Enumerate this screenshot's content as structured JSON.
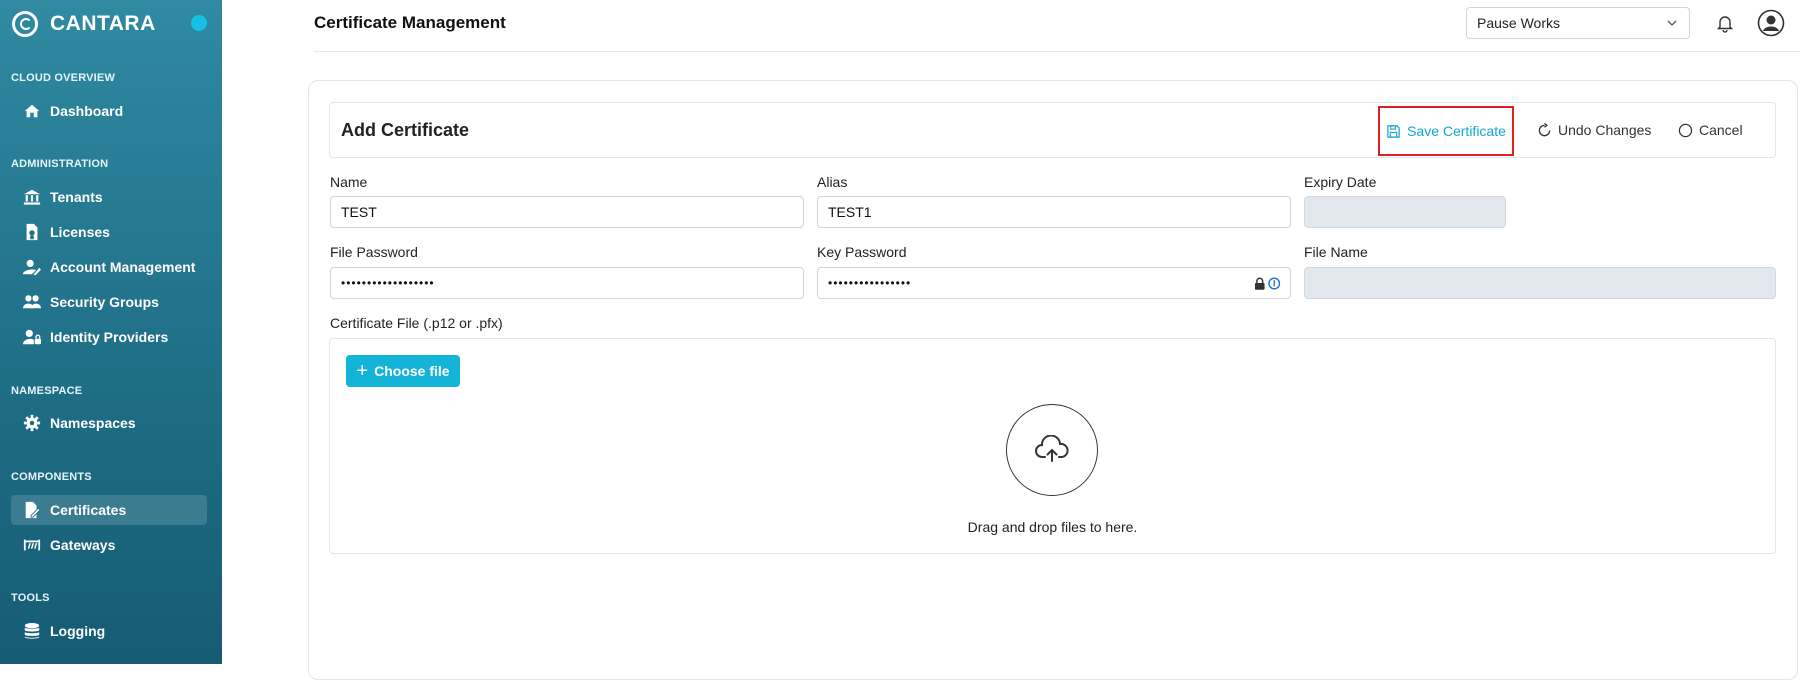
{
  "brand": {
    "name": "CANTARA",
    "status_color": "#16c0e4"
  },
  "sidebar": {
    "sections": [
      {
        "title": "CLOUD OVERVIEW",
        "items": [
          {
            "label": "Dashboard",
            "icon": "home-icon"
          }
        ]
      },
      {
        "title": "ADMINISTRATION",
        "items": [
          {
            "label": "Tenants",
            "icon": "bank-icon"
          },
          {
            "label": "Licenses",
            "icon": "license-icon"
          },
          {
            "label": "Account Management",
            "icon": "user-edit-icon"
          },
          {
            "label": "Security Groups",
            "icon": "users-icon"
          },
          {
            "label": "Identity Providers",
            "icon": "user-lock-icon"
          }
        ]
      },
      {
        "title": "NAMESPACE",
        "items": [
          {
            "label": "Namespaces",
            "icon": "gear-icon"
          }
        ]
      },
      {
        "title": "COMPONENTS",
        "items": [
          {
            "label": "Certificates",
            "icon": "certificate-icon",
            "active": true
          },
          {
            "label": "Gateways",
            "icon": "gateway-icon"
          }
        ]
      },
      {
        "title": "TOOLS",
        "items": [
          {
            "label": "Logging",
            "icon": "database-icon"
          }
        ]
      }
    ]
  },
  "header": {
    "title": "Certificate Management",
    "tenant_selected": "Pause Works"
  },
  "form": {
    "title": "Add Certificate",
    "actions": {
      "save": "Save Certificate",
      "undo": "Undo Changes",
      "cancel": "Cancel"
    },
    "fields": {
      "name": {
        "label": "Name",
        "value": "TEST"
      },
      "alias": {
        "label": "Alias",
        "value": "TEST1"
      },
      "expiry": {
        "label": "Expiry Date",
        "value": ""
      },
      "file_password": {
        "label": "File Password",
        "value": "••••••••••••••••••"
      },
      "key_password": {
        "label": "Key Password",
        "value": "••••••••••••••••"
      },
      "file_name": {
        "label": "File Name",
        "value": ""
      }
    },
    "upload": {
      "label": "Certificate File (.p12 or .pfx)",
      "choose_label": "Choose file",
      "drop_text": "Drag and drop files to here."
    }
  },
  "colors": {
    "accent": "#14b4d8",
    "highlight_border": "#e0201e",
    "sidebar": "#1f6f87"
  }
}
